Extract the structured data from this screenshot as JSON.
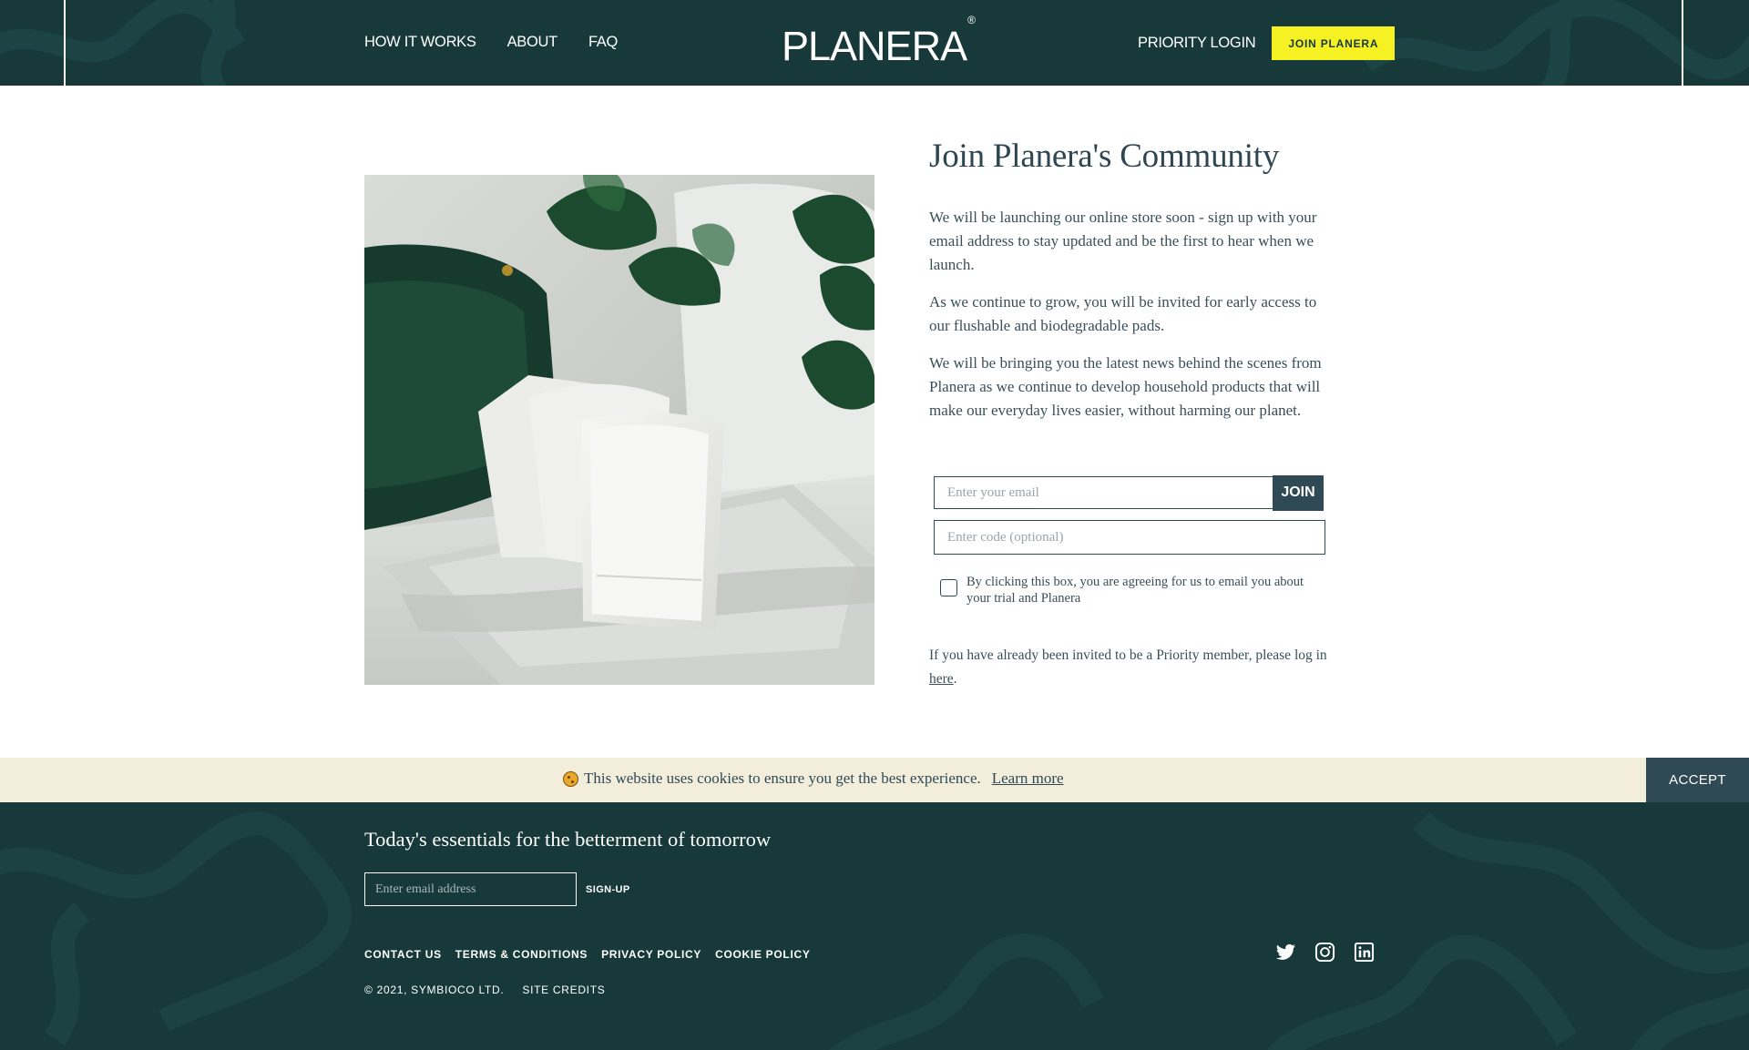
{
  "header": {
    "nav_left": [
      {
        "label": "HOW IT WORKS"
      },
      {
        "label": "ABOUT"
      },
      {
        "label": "FAQ"
      }
    ],
    "logo_text": "PLANERA",
    "logo_mark": "®",
    "priority_login": "PRIORITY LOGIN",
    "join_button": "JOIN PLANERA"
  },
  "main": {
    "title": "Join Planera's Community",
    "paragraphs": [
      "We will be launching our online store soon - sign up with your email address to stay updated and be the first to hear when we launch.",
      "As we continue to grow, you will be invited for early access to our flushable and biodegradable pads.",
      "We will be bringing you the latest news behind the scenes from Planera as we continue to develop household products that will make our everyday lives easier, without harming our planet."
    ],
    "email_placeholder": "Enter your email",
    "join_submit": "JOIN",
    "code_placeholder": "Enter code (optional)",
    "consent_text": "By clicking this box, you are agreeing for us to email you about your trial and Planera",
    "priority_note_prefix": "If you have already been invited to be a Priority member, please log in ",
    "priority_note_link": "here",
    "priority_note_suffix": "."
  },
  "cookie": {
    "icon": "cookie-icon",
    "text": "This website uses cookies to ensure you get the best experience.",
    "learn_more": "Learn more",
    "accept": "ACCEPT"
  },
  "footer": {
    "tagline": "Today's essentials for the betterment of tomorrow",
    "email_placeholder": "Enter email address",
    "signup": "SIGN-UP",
    "links": [
      {
        "label": "CONTACT US"
      },
      {
        "label": "TERMS & CONDITIONS"
      },
      {
        "label": "PRIVACY POLICY"
      },
      {
        "label": "COOKIE POLICY"
      }
    ],
    "copyright": "© 2021, SYMBIOCO LTD.",
    "credits": "SITE CREDITS",
    "socials": [
      "twitter-icon",
      "instagram-icon",
      "linkedin-icon"
    ]
  },
  "colors": {
    "brand_dark": "#17393a",
    "accent_yellow": "#f6f122",
    "text_slate": "#2f4a55",
    "cookie_bg": "#f3eedc"
  }
}
